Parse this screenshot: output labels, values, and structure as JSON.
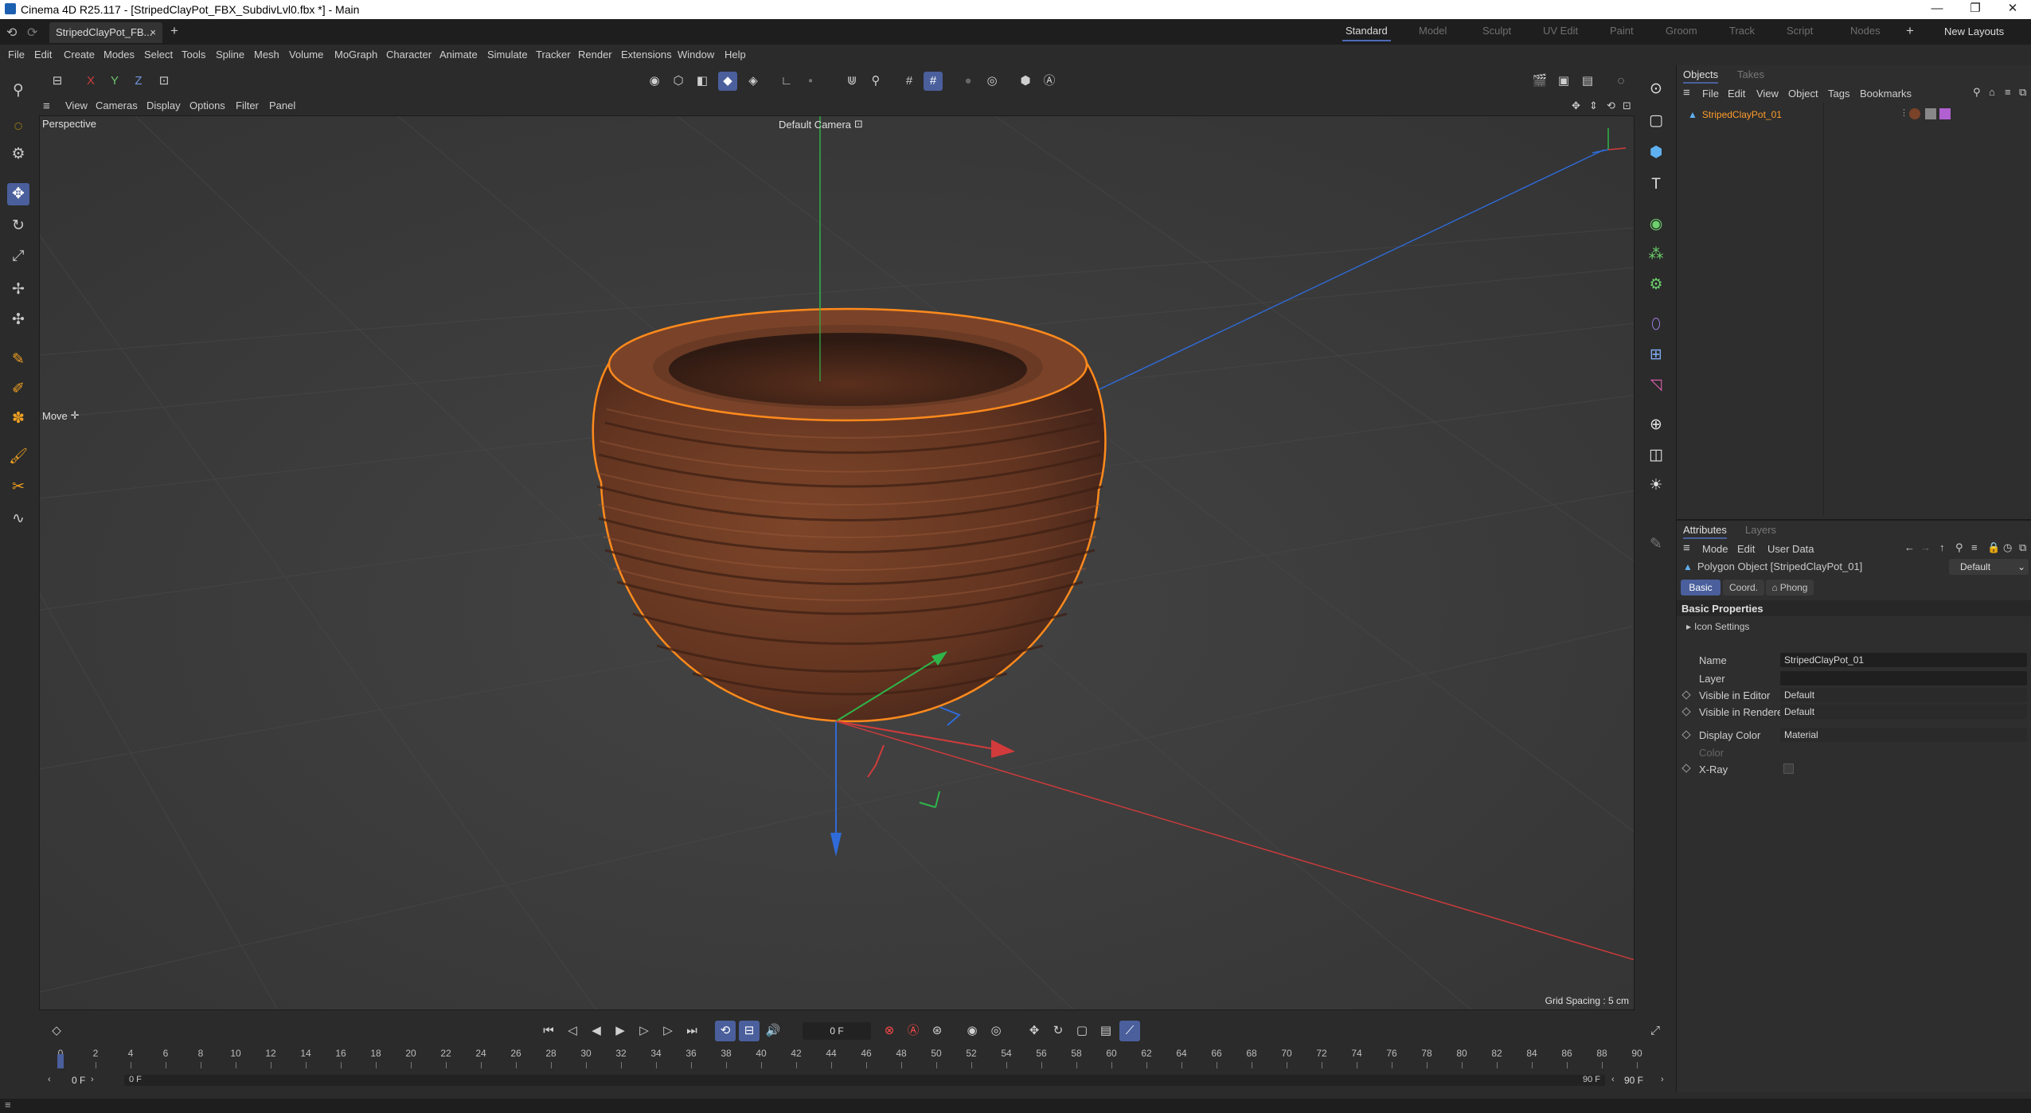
{
  "window": {
    "title": "Cinema 4D R25.117 - [StripedClayPot_FBX_SubdivLvl0.fbx *] - Main",
    "min_glyph": "—",
    "restore_glyph": "❐",
    "close_glyph": "✕"
  },
  "tabs": {
    "document": "StripedClayPot_FB...",
    "close_glyph": "×",
    "add_glyph": "+",
    "layouts": [
      "Standard",
      "Model",
      "Sculpt",
      "UV Edit",
      "Paint",
      "Groom",
      "Track",
      "Script",
      "Nodes"
    ],
    "new_layouts": "New Layouts",
    "add_layout": "+"
  },
  "menu": [
    "File",
    "Edit",
    "Create",
    "Modes",
    "Select",
    "Tools",
    "Spline",
    "Mesh",
    "Volume",
    "MoGraph",
    "Character",
    "Animate",
    "Simulate",
    "Tracker",
    "Render",
    "Extensions",
    "Window",
    "Help"
  ],
  "axis_toggles": {
    "x": "X",
    "y": "Y",
    "z": "Z"
  },
  "viewport": {
    "menu": [
      "View",
      "Cameras",
      "Display",
      "Options",
      "Filter",
      "Panel"
    ],
    "label": "Perspective",
    "camera": "Default Camera",
    "camera_glyph": "⊡",
    "tool_label": "Move",
    "tool_glyph": "✛",
    "grid_spacing": "Grid Spacing : 5 cm"
  },
  "objects_panel": {
    "tabs": [
      "Objects",
      "Takes"
    ],
    "menu": [
      "File",
      "Edit",
      "View",
      "Object",
      "Tags",
      "Bookmarks"
    ],
    "object_name": "StripedClayPot_01"
  },
  "attributes_panel": {
    "tabs": [
      "Attributes",
      "Layers"
    ],
    "menu": [
      "Mode",
      "Edit",
      "User Data"
    ],
    "object_title": "Polygon Object [StripedClayPot_01]",
    "preset": "Default",
    "subtabs": [
      "Basic",
      "Coord.",
      "Phong"
    ],
    "phong_glyph": "⌂",
    "section": "Basic Properties",
    "icon_settings": "Icon Settings",
    "fields": {
      "name_label": "Name",
      "name_value": "StripedClayPot_01",
      "layer_label": "Layer",
      "visible_editor_label": "Visible in Editor",
      "visible_editor_value": "Default",
      "visible_renderer_label": "Visible in Renderer",
      "visible_renderer_value": "Default",
      "display_color_label": "Display Color",
      "display_color_value": "Material",
      "color_label": "Color",
      "xray_label": "X-Ray"
    }
  },
  "timeline": {
    "current_frame": "0 F",
    "start_frame": "0 F",
    "range_start": "0 F",
    "range_end": "90 F",
    "end_frame": "90 F",
    "ticks": [
      "0",
      "2",
      "4",
      "6",
      "8",
      "10",
      "12",
      "14",
      "16",
      "18",
      "20",
      "22",
      "24",
      "26",
      "28",
      "30",
      "32",
      "34",
      "36",
      "38",
      "40",
      "42",
      "44",
      "46",
      "48",
      "50",
      "52",
      "54",
      "56",
      "58",
      "60",
      "62",
      "64",
      "66",
      "68",
      "70",
      "72",
      "74",
      "76",
      "78",
      "80",
      "82",
      "84",
      "86",
      "88",
      "90"
    ]
  },
  "colors": {
    "accent": "#4a5f9c",
    "pot": "#6e3a22",
    "selection": "#ff8a1c",
    "x_axis": "#d23b3b",
    "y_axis": "#2fb54a",
    "z_axis": "#2f6bd8"
  }
}
